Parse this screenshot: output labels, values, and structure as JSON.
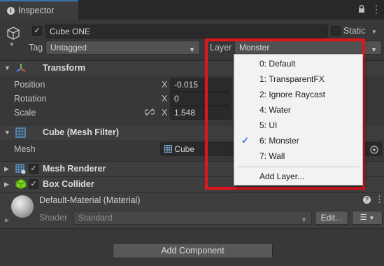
{
  "tab": {
    "title": "Inspector",
    "info_glyph": "i",
    "lock_glyph": "🔒",
    "menu_glyph": "⋮"
  },
  "object": {
    "name": "Cube ONE",
    "static_label": "Static",
    "tag_label": "Tag",
    "tag_value": "Untagged",
    "layer_label": "Layer",
    "layer_value": "Monster"
  },
  "transform": {
    "title": "Transform",
    "position_label": "Position",
    "rotation_label": "Rotation",
    "scale_label": "Scale",
    "x_axis": "X",
    "position_x": "-0.015",
    "rotation_x": "0",
    "scale_x": "1.548"
  },
  "mesh_filter": {
    "title": "Cube (Mesh Filter)",
    "mesh_label": "Mesh",
    "mesh_value": "Cube"
  },
  "mesh_renderer": {
    "title": "Mesh Renderer"
  },
  "box_collider": {
    "title": "Box Collider"
  },
  "material": {
    "title": "Default-Material (Material)",
    "shader_label": "Shader",
    "shader_value": "Standard",
    "edit_label": "Edit...",
    "list_glyph": "☰"
  },
  "add_component": {
    "label": "Add Component"
  },
  "layer_menu": {
    "items": [
      {
        "label": "0: Default",
        "checked": false
      },
      {
        "label": "1: TransparentFX",
        "checked": false
      },
      {
        "label": "2: Ignore Raycast",
        "checked": false
      },
      {
        "label": "4: Water",
        "checked": false
      },
      {
        "label": "5: UI",
        "checked": false
      },
      {
        "label": "6: Monster",
        "checked": true
      },
      {
        "label": "7: Wall",
        "checked": false
      }
    ],
    "add_label": "Add Layer...",
    "check_glyph": "✓"
  },
  "colors": {
    "accent": "#3a72b0",
    "highlight": "#e1151e",
    "menu_check": "#2f75d6",
    "background": "#383838"
  }
}
